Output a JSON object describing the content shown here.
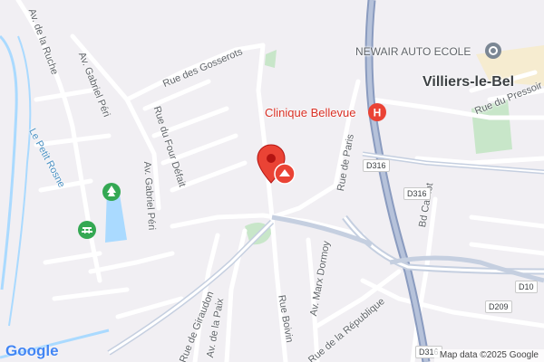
{
  "map": {
    "labels": {
      "av_de_la_ruche": "Av. de la Ruche",
      "av_gabriel_peri_1": "Av. Gabriel Péri",
      "av_gabriel_peri_2": "Av. Gabriel Péri",
      "rue_des_gosserots": "Rue des Gosserots",
      "rue_du_four_defait": "Rue du Four Défait",
      "le_petit_rosne": "Le Petit Rosne",
      "rue_de_paris": "Rue de Paris",
      "av_marx_dormoy": "Av. Marx Dormoy",
      "rue_boivin": "Rue Boivin",
      "rue_de_la_republique": "Rue de la République",
      "rue_de_giraudon": "Rue de Giraudon",
      "av_de_la_paix": "Av. de la Paix",
      "bd_carnot": "Bd Carnot",
      "rue_du_pressoir": "Rue du Pressoir",
      "town": "Villiers-le-Bel"
    },
    "pois": {
      "driving_school": "NEWAIR AUTO ECOLE",
      "clinic": "Clinique Bellevue"
    },
    "shields": {
      "d316_a": "D316",
      "d316_b": "D316",
      "d316_c": "D316",
      "d10": "D10",
      "d209": "D209"
    },
    "attribution": "Map data ©2025 Google",
    "logo": "Google",
    "colors": {
      "background": "#f1eff3",
      "road": "#ffffff",
      "major_road": "#c5cfe0",
      "water": "#aadaff",
      "park": "#c8e6c9",
      "clinic": "#ea4335",
      "pin": "#ea4335"
    },
    "icons": [
      "map-pin-icon",
      "clinic-icon",
      "driving-school-icon",
      "park-tree-icon",
      "picnic-icon"
    ]
  }
}
